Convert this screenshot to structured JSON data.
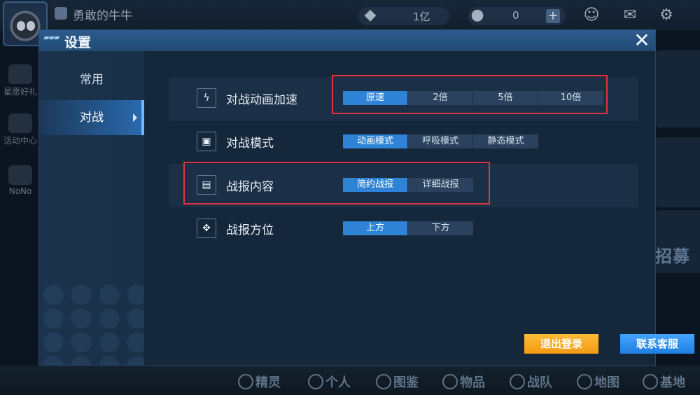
{
  "player": {
    "name": "勇敢的牛牛"
  },
  "top_bar": {
    "currency_1": "1亿",
    "currency_2": "0",
    "plus_label": "+"
  },
  "left_menu": [
    "星愿好礼",
    "活动中心",
    "NoNo"
  ],
  "right_banner": "招募",
  "dialog": {
    "title": "设置",
    "close_label": "✕",
    "nav": [
      {
        "label": "常用",
        "active": false
      },
      {
        "label": "对战",
        "active": true
      }
    ],
    "settings": [
      {
        "label": "对战动画加速",
        "icon": "lightning-icon",
        "options": [
          "原速",
          "2倍",
          "5倍",
          "10倍"
        ],
        "selected": 0
      },
      {
        "label": "对战模式",
        "icon": "mode-icon",
        "options": [
          "动画模式",
          "呼吸模式",
          "静态模式"
        ],
        "selected": 0
      },
      {
        "label": "战报内容",
        "icon": "report-icon",
        "options": [
          "简约战报",
          "详细战报"
        ],
        "selected": 0
      },
      {
        "label": "战报方位",
        "icon": "move-icon",
        "options": [
          "上方",
          "下方"
        ],
        "selected": 0
      }
    ],
    "buttons": {
      "logout": "退出登录",
      "support": "联系客服"
    }
  },
  "bottom_nav": [
    "精灵",
    "个人",
    "图鉴",
    "物品",
    "战队",
    "地图",
    "基地"
  ],
  "colors": {
    "accent": "#2f83d6",
    "highlight_box": "#e0353e",
    "logout_button": "#f39a12",
    "support_button": "#1f7fe0"
  }
}
